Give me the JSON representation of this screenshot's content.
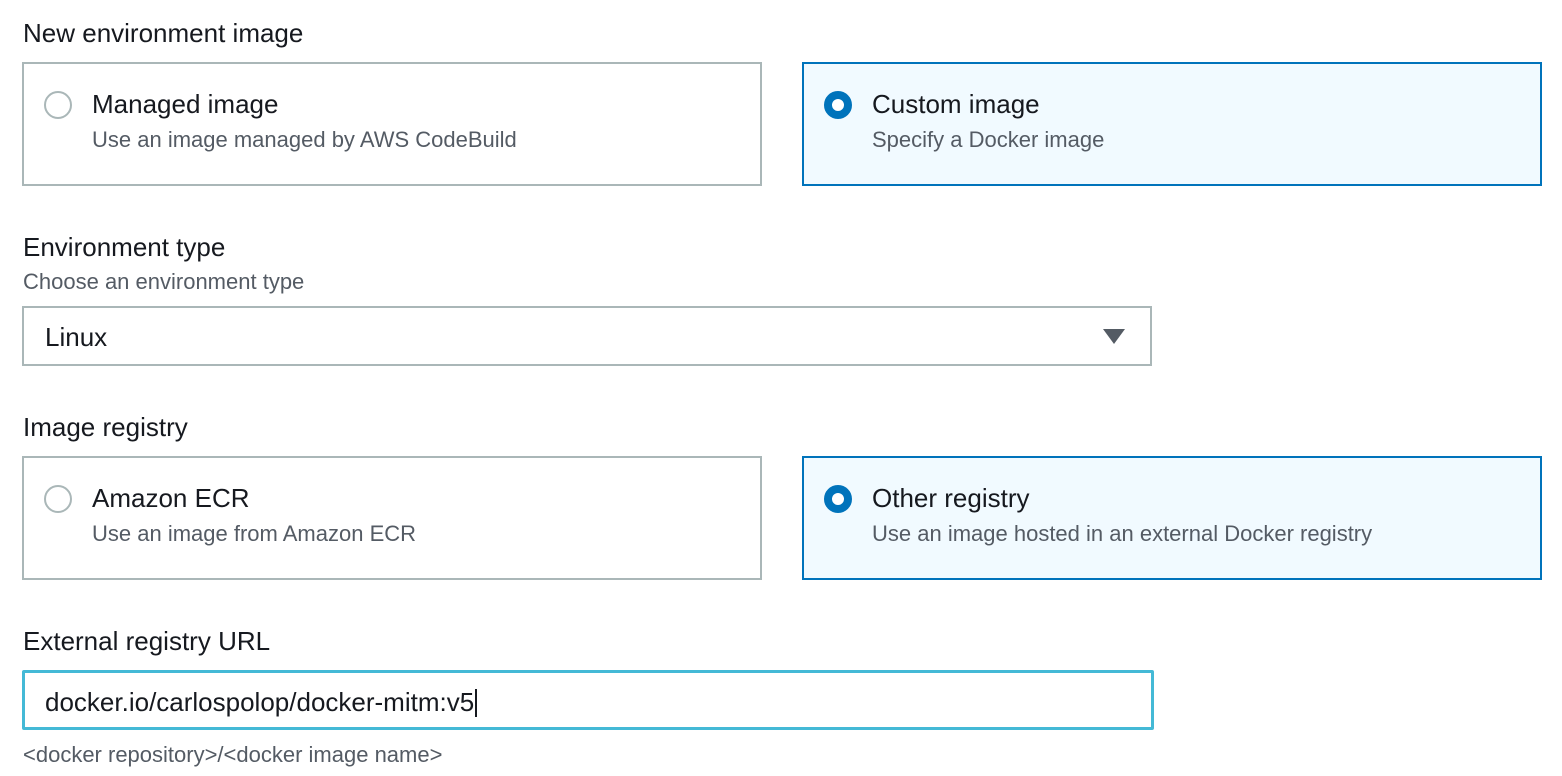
{
  "environment_image": {
    "label": "New environment image",
    "options": [
      {
        "title": "Managed image",
        "description": "Use an image managed by AWS CodeBuild",
        "selected": false
      },
      {
        "title": "Custom image",
        "description": "Specify a Docker image",
        "selected": true
      }
    ]
  },
  "environment_type": {
    "label": "Environment type",
    "description": "Choose an environment type",
    "selected_value": "Linux"
  },
  "image_registry": {
    "label": "Image registry",
    "options": [
      {
        "title": "Amazon ECR",
        "description": "Use an image from Amazon ECR",
        "selected": false
      },
      {
        "title": "Other registry",
        "description": "Use an image hosted in an external Docker registry",
        "selected": true
      }
    ]
  },
  "external_registry_url": {
    "label": "External registry URL",
    "value": "docker.io/carlospolop/docker-mitm:v5",
    "hint": "<docker repository>/<docker image name>"
  },
  "colors": {
    "accent": "#0073bb",
    "selected_tile_bg": "#f1faff",
    "border": "#aab7b8",
    "focus_border": "#44b9d6",
    "text": "#16191f",
    "secondary_text": "#545b64"
  }
}
